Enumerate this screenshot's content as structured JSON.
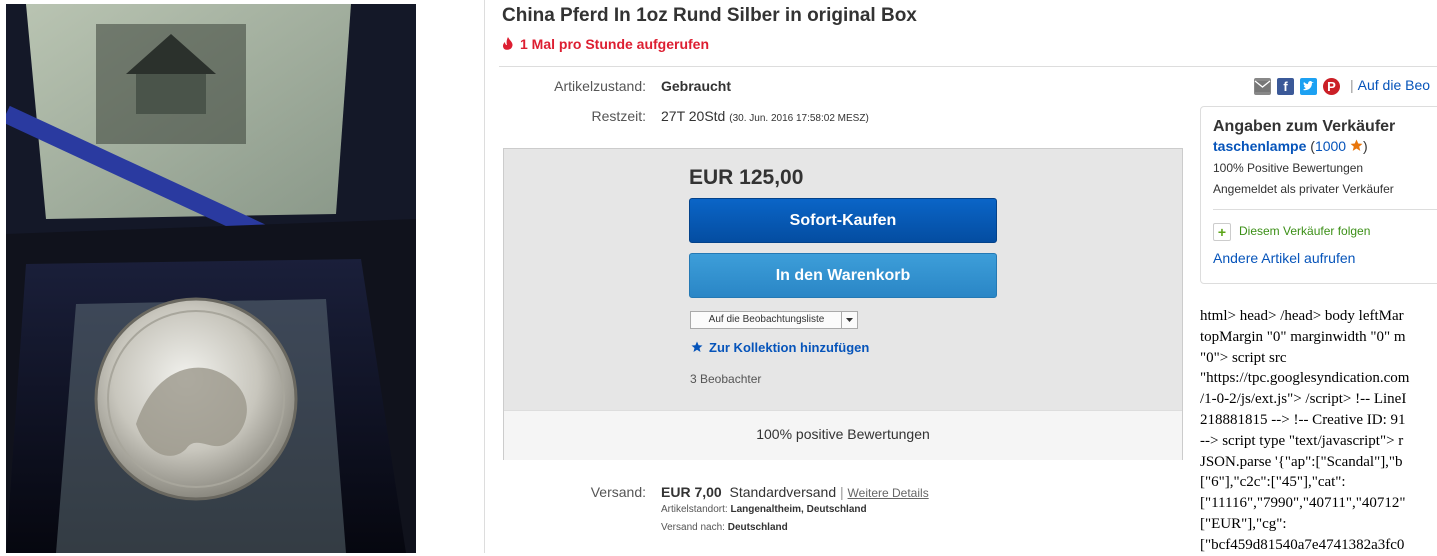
{
  "listing": {
    "title": "China Pferd In 1oz Rund Silber in original Box",
    "views_text": "1 Mal pro Stunde aufgerufen"
  },
  "details": {
    "condition_label": "Artikelzustand:",
    "condition_value": "Gebraucht",
    "time_label": "Restzeit:",
    "time_value": "27T 20Std",
    "time_end": "(30. Jun. 2016   17:58:02 MESZ)"
  },
  "share": {
    "watch_link": "Auf die Beo"
  },
  "buy": {
    "price": "EUR 125,00",
    "buy_now": "Sofort-Kaufen",
    "add_cart": "In den Warenkorb",
    "watchlist": "Auf die Beobachtungsliste",
    "collection": "Zur Kollektion hinzufügen",
    "watchers": "3 Beobachter",
    "positive": "100% positive Bewertungen"
  },
  "shipping": {
    "label": "Versand:",
    "price": "EUR 7,00",
    "method": "Standardversand",
    "details_link": "Weitere Details",
    "location_label": "Artikelstandort:",
    "location_value": "Langenaltheim, Deutschland",
    "ship_to_label": "Versand nach:",
    "ship_to_value": "Deutschland"
  },
  "seller": {
    "heading": "Angaben zum Verkäufer",
    "name": "taschenlampe",
    "score": "1000",
    "positive": "100% Positive Bewertungen",
    "type": "Angemeldet als privater Verkäufer",
    "follow": "Diesem Verkäufer folgen",
    "other_items": "Andere Artikel aufrufen"
  },
  "raw_code": [
    "html> head> /head> body leftMar",
    "topMargin \"0\" marginwidth \"0\" m",
    "\"0\"> script src",
    "\"https://tpc.googlesyndication.com",
    "/1-0-2/js/ext.js\"> /script> !-- LineI",
    "218881815 --> !-- Creative ID: 91",
    "--> script type \"text/javascript\"> r",
    "JSON.parse '{\"ap\":[\"Scandal\"],\"b",
    "[\"6\"],\"c2c\":[\"45\"],\"cat\":",
    "[\"11116\",\"7990\",\"40711\",\"40712\"",
    "[\"EUR\"],\"cg\":",
    "[\"bcf459d81540a7e4741382a3fc0"
  ],
  "colors": {
    "accent": "#0654ba",
    "buy_button": "#0654ba",
    "cart_button": "#3498db",
    "alert": "#dd1e31"
  },
  "icons": [
    "flame-icon",
    "email-icon",
    "facebook-icon",
    "twitter-icon",
    "pinterest-icon",
    "star-icon",
    "plus-icon",
    "chevron-down-icon"
  ]
}
